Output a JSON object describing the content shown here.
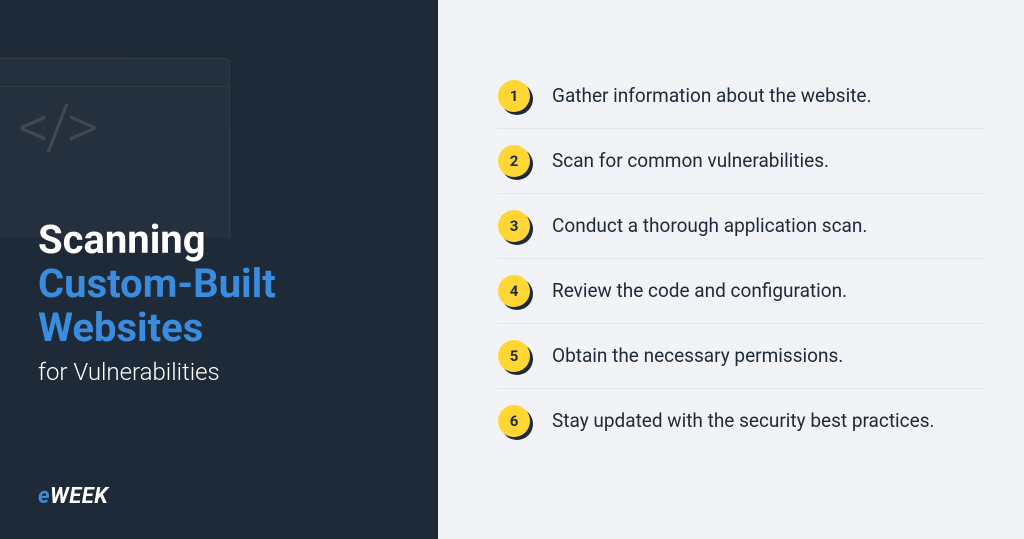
{
  "left": {
    "title_line1": "Scanning",
    "title_line2": "Custom-Built",
    "title_line3": "Websites",
    "subtitle": "for Vulnerabilities",
    "logo_prefix": "e",
    "logo_text": "WEEK",
    "code_glyph": "</>"
  },
  "steps": [
    {
      "num": "1",
      "text": "Gather information about the website."
    },
    {
      "num": "2",
      "text": "Scan for common vulnerabilities."
    },
    {
      "num": "3",
      "text": "Conduct a thorough application scan."
    },
    {
      "num": "4",
      "text": "Review the code and configuration."
    },
    {
      "num": "5",
      "text": "Obtain the necessary permissions."
    },
    {
      "num": "6",
      "text": "Stay updated with the security best practices."
    }
  ],
  "colors": {
    "dark_bg": "#1e2a38",
    "light_bg": "#f2f3f7",
    "accent_blue": "#3a8dde",
    "badge_yellow": "#ffd633"
  }
}
